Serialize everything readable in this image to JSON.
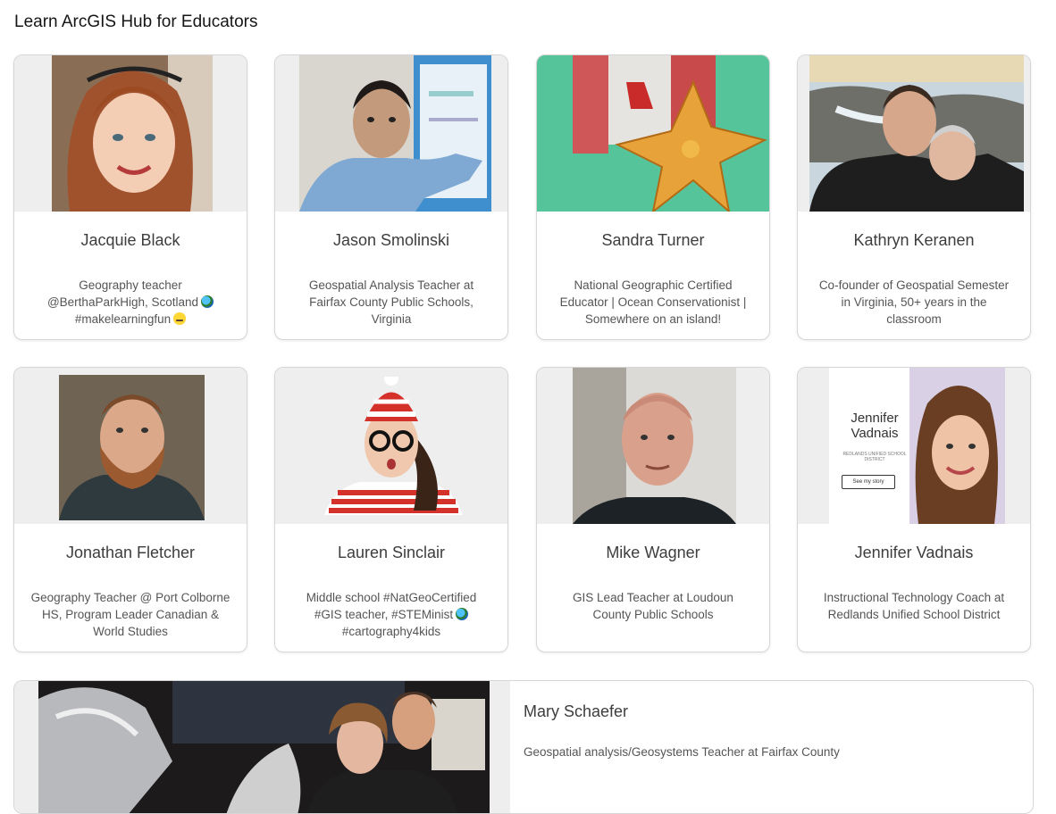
{
  "page": {
    "title": "Learn ArcGIS Hub for Educators"
  },
  "educators": [
    {
      "name": "Jacquie Black",
      "bio_lines": [
        "Geography teacher",
        "@BerthaParkHigh, Scotland",
        "#makelearningfun"
      ]
    },
    {
      "name": "Jason Smolinski",
      "bio_lines": [
        "Geospatial Analysis Teacher at",
        "Fairfax County Public Schools,",
        "Virginia"
      ]
    },
    {
      "name": "Sandra Turner",
      "bio_lines": [
        "National Geographic Certified",
        "Educator | Ocean Conservationist |",
        "Somewhere on an island!"
      ]
    },
    {
      "name": "Kathryn Keranen",
      "bio_lines": [
        "Co-founder of Geospatial Semester",
        "in Virginia, 50+ years in the",
        "classroom"
      ]
    },
    {
      "name": "Jonathan Fletcher",
      "bio_lines": [
        "Geography Teacher @ Port Colborne",
        "HS, Program Leader Canadian &",
        "World Studies"
      ]
    },
    {
      "name": "Lauren Sinclair",
      "bio_lines": [
        "Middle school #NatGeoCertified",
        "#GIS teacher, #STEMinist",
        "#cartography4kids"
      ]
    },
    {
      "name": "Mike Wagner",
      "bio_lines": [
        "GIS Lead Teacher at Loudoun",
        "County Public Schools"
      ]
    },
    {
      "name": "Jennifer Vadnais",
      "bio_lines": [
        "Instructional Technology Coach at",
        "Redlands Unified School District"
      ]
    }
  ],
  "featured": {
    "name": "Mary Schaefer",
    "bio": "Geospatial analysis/Geosystems Teacher at Fairfax County"
  },
  "photo_text": {
    "vadnais_name_line1": "Jennifer",
    "vadnais_name_line2": "Vadnais",
    "vadnais_district": "REDLANDS UNIFIED SCHOOL DISTRICT",
    "vadnais_button": "See my story"
  }
}
